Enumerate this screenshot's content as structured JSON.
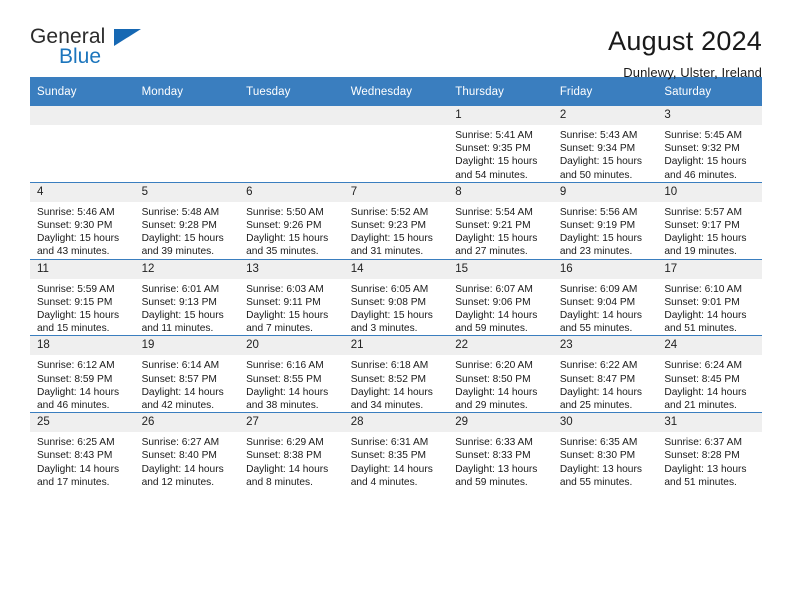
{
  "brand": {
    "name_top": "General",
    "name_bottom": "Blue",
    "accent_color": "#1668b3"
  },
  "header": {
    "title": "August 2024",
    "subtitle": "Dunlewy, Ulster, Ireland"
  },
  "calendar": {
    "header_bg": "#3a7ebf",
    "daynum_bg": "#efefef",
    "weekday_headers": [
      "Sunday",
      "Monday",
      "Tuesday",
      "Wednesday",
      "Thursday",
      "Friday",
      "Saturday"
    ],
    "weeks": [
      [
        {
          "day": ""
        },
        {
          "day": ""
        },
        {
          "day": ""
        },
        {
          "day": ""
        },
        {
          "day": "1",
          "sunrise": "Sunrise: 5:41 AM",
          "sunset": "Sunset: 9:35 PM",
          "daylight": "Daylight: 15 hours and 54 minutes."
        },
        {
          "day": "2",
          "sunrise": "Sunrise: 5:43 AM",
          "sunset": "Sunset: 9:34 PM",
          "daylight": "Daylight: 15 hours and 50 minutes."
        },
        {
          "day": "3",
          "sunrise": "Sunrise: 5:45 AM",
          "sunset": "Sunset: 9:32 PM",
          "daylight": "Daylight: 15 hours and 46 minutes."
        }
      ],
      [
        {
          "day": "4",
          "sunrise": "Sunrise: 5:46 AM",
          "sunset": "Sunset: 9:30 PM",
          "daylight": "Daylight: 15 hours and 43 minutes."
        },
        {
          "day": "5",
          "sunrise": "Sunrise: 5:48 AM",
          "sunset": "Sunset: 9:28 PM",
          "daylight": "Daylight: 15 hours and 39 minutes."
        },
        {
          "day": "6",
          "sunrise": "Sunrise: 5:50 AM",
          "sunset": "Sunset: 9:26 PM",
          "daylight": "Daylight: 15 hours and 35 minutes."
        },
        {
          "day": "7",
          "sunrise": "Sunrise: 5:52 AM",
          "sunset": "Sunset: 9:23 PM",
          "daylight": "Daylight: 15 hours and 31 minutes."
        },
        {
          "day": "8",
          "sunrise": "Sunrise: 5:54 AM",
          "sunset": "Sunset: 9:21 PM",
          "daylight": "Daylight: 15 hours and 27 minutes."
        },
        {
          "day": "9",
          "sunrise": "Sunrise: 5:56 AM",
          "sunset": "Sunset: 9:19 PM",
          "daylight": "Daylight: 15 hours and 23 minutes."
        },
        {
          "day": "10",
          "sunrise": "Sunrise: 5:57 AM",
          "sunset": "Sunset: 9:17 PM",
          "daylight": "Daylight: 15 hours and 19 minutes."
        }
      ],
      [
        {
          "day": "11",
          "sunrise": "Sunrise: 5:59 AM",
          "sunset": "Sunset: 9:15 PM",
          "daylight": "Daylight: 15 hours and 15 minutes."
        },
        {
          "day": "12",
          "sunrise": "Sunrise: 6:01 AM",
          "sunset": "Sunset: 9:13 PM",
          "daylight": "Daylight: 15 hours and 11 minutes."
        },
        {
          "day": "13",
          "sunrise": "Sunrise: 6:03 AM",
          "sunset": "Sunset: 9:11 PM",
          "daylight": "Daylight: 15 hours and 7 minutes."
        },
        {
          "day": "14",
          "sunrise": "Sunrise: 6:05 AM",
          "sunset": "Sunset: 9:08 PM",
          "daylight": "Daylight: 15 hours and 3 minutes."
        },
        {
          "day": "15",
          "sunrise": "Sunrise: 6:07 AM",
          "sunset": "Sunset: 9:06 PM",
          "daylight": "Daylight: 14 hours and 59 minutes."
        },
        {
          "day": "16",
          "sunrise": "Sunrise: 6:09 AM",
          "sunset": "Sunset: 9:04 PM",
          "daylight": "Daylight: 14 hours and 55 minutes."
        },
        {
          "day": "17",
          "sunrise": "Sunrise: 6:10 AM",
          "sunset": "Sunset: 9:01 PM",
          "daylight": "Daylight: 14 hours and 51 minutes."
        }
      ],
      [
        {
          "day": "18",
          "sunrise": "Sunrise: 6:12 AM",
          "sunset": "Sunset: 8:59 PM",
          "daylight": "Daylight: 14 hours and 46 minutes."
        },
        {
          "day": "19",
          "sunrise": "Sunrise: 6:14 AM",
          "sunset": "Sunset: 8:57 PM",
          "daylight": "Daylight: 14 hours and 42 minutes."
        },
        {
          "day": "20",
          "sunrise": "Sunrise: 6:16 AM",
          "sunset": "Sunset: 8:55 PM",
          "daylight": "Daylight: 14 hours and 38 minutes."
        },
        {
          "day": "21",
          "sunrise": "Sunrise: 6:18 AM",
          "sunset": "Sunset: 8:52 PM",
          "daylight": "Daylight: 14 hours and 34 minutes."
        },
        {
          "day": "22",
          "sunrise": "Sunrise: 6:20 AM",
          "sunset": "Sunset: 8:50 PM",
          "daylight": "Daylight: 14 hours and 29 minutes."
        },
        {
          "day": "23",
          "sunrise": "Sunrise: 6:22 AM",
          "sunset": "Sunset: 8:47 PM",
          "daylight": "Daylight: 14 hours and 25 minutes."
        },
        {
          "day": "24",
          "sunrise": "Sunrise: 6:24 AM",
          "sunset": "Sunset: 8:45 PM",
          "daylight": "Daylight: 14 hours and 21 minutes."
        }
      ],
      [
        {
          "day": "25",
          "sunrise": "Sunrise: 6:25 AM",
          "sunset": "Sunset: 8:43 PM",
          "daylight": "Daylight: 14 hours and 17 minutes."
        },
        {
          "day": "26",
          "sunrise": "Sunrise: 6:27 AM",
          "sunset": "Sunset: 8:40 PM",
          "daylight": "Daylight: 14 hours and 12 minutes."
        },
        {
          "day": "27",
          "sunrise": "Sunrise: 6:29 AM",
          "sunset": "Sunset: 8:38 PM",
          "daylight": "Daylight: 14 hours and 8 minutes."
        },
        {
          "day": "28",
          "sunrise": "Sunrise: 6:31 AM",
          "sunset": "Sunset: 8:35 PM",
          "daylight": "Daylight: 14 hours and 4 minutes."
        },
        {
          "day": "29",
          "sunrise": "Sunrise: 6:33 AM",
          "sunset": "Sunset: 8:33 PM",
          "daylight": "Daylight: 13 hours and 59 minutes."
        },
        {
          "day": "30",
          "sunrise": "Sunrise: 6:35 AM",
          "sunset": "Sunset: 8:30 PM",
          "daylight": "Daylight: 13 hours and 55 minutes."
        },
        {
          "day": "31",
          "sunrise": "Sunrise: 6:37 AM",
          "sunset": "Sunset: 8:28 PM",
          "daylight": "Daylight: 13 hours and 51 minutes."
        }
      ]
    ]
  }
}
